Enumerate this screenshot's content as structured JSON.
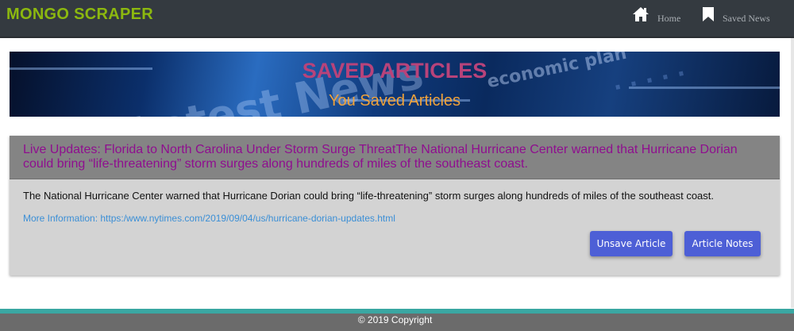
{
  "navbar": {
    "brand": "MONGO SCRAPER",
    "links": [
      {
        "label": "Home",
        "icon": "home-icon"
      },
      {
        "label": "Saved News",
        "icon": "bookmark-icon"
      }
    ]
  },
  "banner": {
    "title": "SAVED ARTICLES",
    "subtitle": "You Saved Articles"
  },
  "articles": [
    {
      "title": "Live Updates: Florida to North Carolina Under Storm Surge ThreatThe National Hurricane Center warned that Hurricane Dorian could bring “life-threatening” storm surges along hundreds of miles of the southeast coast.",
      "summary": "The National Hurricane Center warned that Hurricane Dorian could bring “life-threatening” storm surges along hundreds of miles of the southeast coast.",
      "more_info": "More Information: https:/www.nytimes.com/2019/09/04/us/hurricane-dorian-updates.html",
      "unsave_label": "Unsave Article",
      "notes_label": "Article Notes"
    }
  ],
  "footer": {
    "copyright": "© 2019 Copyright"
  },
  "colors": {
    "navbar_bg": "#343a40",
    "brand": "#8cb80f",
    "banner_title": "#b8437a",
    "banner_subtitle": "#f0a23a",
    "card_bg": "#d3d3d3",
    "card_header_bg": "#848484",
    "card_title": "#8f0e8f",
    "link": "#3b8fd6",
    "button": "#4d5fd6",
    "footer_strip": "#3aa7a2",
    "footer_bg": "#6b6b6b"
  }
}
